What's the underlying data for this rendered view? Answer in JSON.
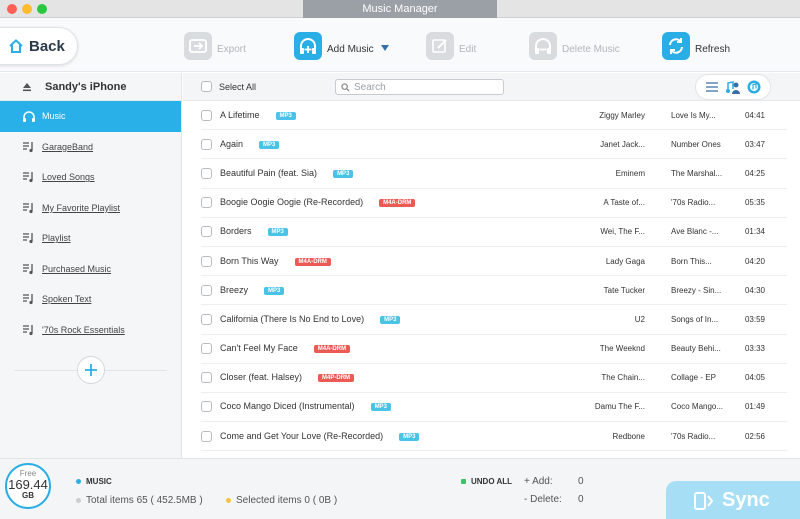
{
  "app": {
    "title": "Music Manager"
  },
  "toolbar": {
    "back_label": "Back",
    "export_label": "Export",
    "add_label": "Add Music",
    "edit_label": "Edit",
    "delete_label": "Delete Music",
    "refresh_label": "Refresh",
    "accent_color": "#2aaee6"
  },
  "sidebar": {
    "device_name": "Sandy's iPhone",
    "items": [
      {
        "label": "Music",
        "icon": "headphones-icon",
        "active": true
      },
      {
        "label": "GarageBand",
        "icon": "playlist-icon"
      },
      {
        "label": "Loved Songs",
        "icon": "playlist-icon"
      },
      {
        "label": "My Favorite Playlist",
        "icon": "playlist-icon"
      },
      {
        "label": "Playlist",
        "icon": "playlist-icon"
      },
      {
        "label": "Purchased Music",
        "icon": "playlist-icon"
      },
      {
        "label": "Spoken Text",
        "icon": "playlist-icon"
      },
      {
        "label": "'70s Rock Essentials",
        "icon": "playlist-icon"
      }
    ]
  },
  "list": {
    "select_all_label": "Select All",
    "search_placeholder": "Search",
    "rows": [
      {
        "title": "A Lifetime",
        "format": "MP3",
        "artist": "Ziggy Marley",
        "album": "Love Is My...",
        "duration": "04:41"
      },
      {
        "title": "Again",
        "format": "MP3",
        "artist": "Janet Jack...",
        "album": "Number Ones",
        "duration": "03:47"
      },
      {
        "title": "Beautiful Pain (feat. Sia)",
        "format": "MP3",
        "artist": "Eminem",
        "album": "The Marshal...",
        "duration": "04:25"
      },
      {
        "title": "Boogie Oogie Oogie (Re-Recorded)",
        "format": "M4A-DRM",
        "artist": "A Taste of...",
        "album": "'70s Radio...",
        "duration": "05:35"
      },
      {
        "title": "Borders",
        "format": "MP3",
        "artist": "Wei, The F...",
        "album": "Ave Blanc -...",
        "duration": "01:34"
      },
      {
        "title": "Born This Way",
        "format": "M4A-DRM",
        "artist": "Lady Gaga",
        "album": "Born This...",
        "duration": "04:20"
      },
      {
        "title": "Breezy",
        "format": "MP3",
        "artist": "Tate Tucker",
        "album": "Breezy - Sin...",
        "duration": "04:30"
      },
      {
        "title": "California (There Is No End to Love)",
        "format": "MP3",
        "artist": "U2",
        "album": "Songs of In...",
        "duration": "03:59"
      },
      {
        "title": "Can't Feel My Face",
        "format": "M4A-DRM",
        "artist": "The Weeknd",
        "album": "Beauty Behi...",
        "duration": "03:33"
      },
      {
        "title": "Closer (feat. Halsey)",
        "format": "M4P-DRM",
        "artist": "The Chain...",
        "album": "Collage - EP",
        "duration": "04:05"
      },
      {
        "title": "Coco Mango Diced (Instrumental)",
        "format": "MP3",
        "artist": "Damu The F...",
        "album": "Coco Mango...",
        "duration": "01:49"
      },
      {
        "title": "Come and Get Your Love (Re-Recorded)",
        "format": "MP3",
        "artist": "Redbone",
        "album": "'70s Radio...",
        "duration": "02:56"
      }
    ]
  },
  "footer": {
    "storage_free_label": "Free",
    "storage_value": "169.44",
    "storage_unit": "GB",
    "section_label": "MUSIC",
    "total_items": "Total items 65 ( 452.5MB )",
    "selected_items": "Selected items 0 ( 0B )",
    "undo_all_label": "UNDO ALL",
    "add_label": "+ Add:",
    "add_count": "0",
    "delete_label": "- Delete:",
    "delete_count": "0",
    "sync_label": "Sync"
  }
}
